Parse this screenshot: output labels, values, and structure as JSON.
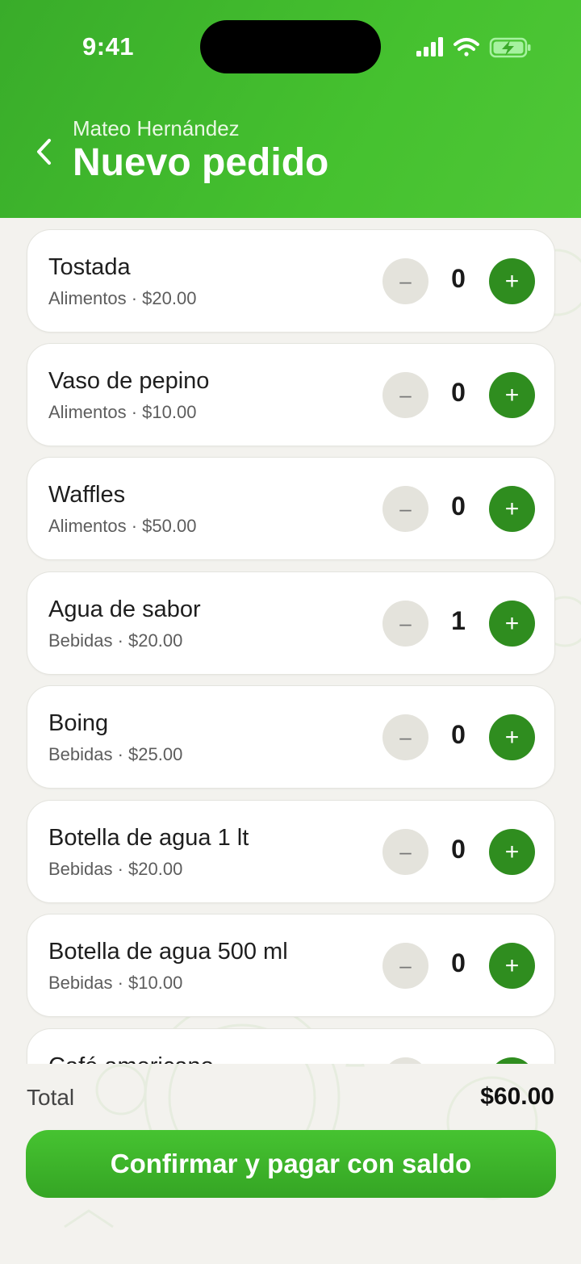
{
  "status_bar": {
    "time": "9:41"
  },
  "header": {
    "subtitle": "Mateo Hernández",
    "title": "Nuevo pedido"
  },
  "products": [
    {
      "name": "Tostada",
      "category": "Alimentos",
      "price": "$20.00",
      "meta": "Alimentos · $20.00",
      "qty": "0"
    },
    {
      "name": "Vaso de pepino",
      "category": "Alimentos",
      "price": "$10.00",
      "meta": "Alimentos · $10.00",
      "qty": "0"
    },
    {
      "name": "Waffles",
      "category": "Alimentos",
      "price": "$50.00",
      "meta": "Alimentos · $50.00",
      "qty": "0"
    },
    {
      "name": "Agua de sabor",
      "category": "Bebidas",
      "price": "$20.00",
      "meta": "Bebidas · $20.00",
      "qty": "1"
    },
    {
      "name": "Boing",
      "category": "Bebidas",
      "price": "$25.00",
      "meta": "Bebidas · $25.00",
      "qty": "0"
    },
    {
      "name": "Botella de agua 1 lt",
      "category": "Bebidas",
      "price": "$20.00",
      "meta": "Bebidas · $20.00",
      "qty": "0"
    },
    {
      "name": "Botella de agua 500 ml",
      "category": "Bebidas",
      "price": "$10.00",
      "meta": "Bebidas · $10.00",
      "qty": "0"
    },
    {
      "name": "Café americano",
      "category": "",
      "price": "",
      "meta": "",
      "qty": ""
    }
  ],
  "controls": {
    "minus_label": "–",
    "plus_label": "+"
  },
  "footer": {
    "total_label": "Total",
    "total_value": "$60.00",
    "confirm_label": "Confirmar y pagar con saldo"
  },
  "colors": {
    "header_green": "#41b82d",
    "plus_button": "#2f8d1f",
    "minus_button": "#e4e3dc",
    "confirm_button": "#3fb52c",
    "background": "#f3f2ee"
  },
  "icons": [
    "back-chevron-icon",
    "signal-icon",
    "wifi-icon",
    "battery-charging-icon",
    "minus-icon",
    "plus-icon"
  ]
}
